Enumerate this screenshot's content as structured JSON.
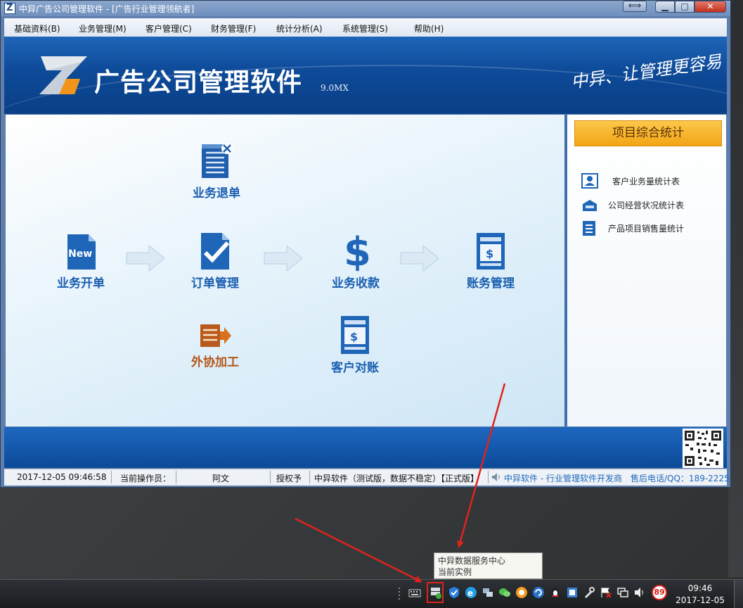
{
  "window": {
    "title": "中异广告公司管理软件 - [广告行业管理领航者]",
    "restore_icon": "⟺",
    "min_icon": "▁",
    "max_icon": "□",
    "close_icon": "✕"
  },
  "menu": [
    {
      "label": "基础资料(B)"
    },
    {
      "label": "业务管理(M)"
    },
    {
      "label": "客户管理(C)"
    },
    {
      "label": "财务管理(F)"
    },
    {
      "label": "统计分析(A)"
    },
    {
      "label": "系统管理(S)"
    },
    {
      "label": "帮助(H)"
    }
  ],
  "banner": {
    "title": "广告公司管理软件",
    "version": "9.0MX",
    "slogan": "中异、让管理更容易"
  },
  "features": {
    "cancel_order": "业务退单",
    "new_business": "业务开单",
    "order_mgmt": "订单管理",
    "collection": "业务收款",
    "accounts": "账务管理",
    "outsourcing": "外协加工",
    "reconciliation": "客户对账",
    "new_badge": "New",
    "dollar": "$"
  },
  "stats": {
    "header": "项目综合统计",
    "links": [
      {
        "label": "客户业务量统计表"
      },
      {
        "label": "公司经营状况统计表"
      },
      {
        "label": "产品项目销售量统计"
      }
    ]
  },
  "statusbar": {
    "datetime": "2017-12-05 09:46:58",
    "operator_label": "当前操作员：",
    "operator": "阿文",
    "license_label": "授权予",
    "license": "中异软件（测试版，数据不稳定）【正式版】",
    "company": "中异软件 - 行业管理软件开发商",
    "hotline": "售后电话/QQ：189-2225"
  },
  "tooltip": {
    "line1": "中异数据服务中心",
    "line2": "当前实例 (local)\\DBServer"
  },
  "taskbar": {
    "badge": "89",
    "time": "09:46",
    "date": "2017-12-05"
  },
  "colors": {
    "accent_blue": "#0d4a98",
    "feature_text": "#1a5fb0",
    "outsource_text": "#b35418",
    "stats_header": "#f2a516",
    "annotation_red": "#e0231c"
  }
}
